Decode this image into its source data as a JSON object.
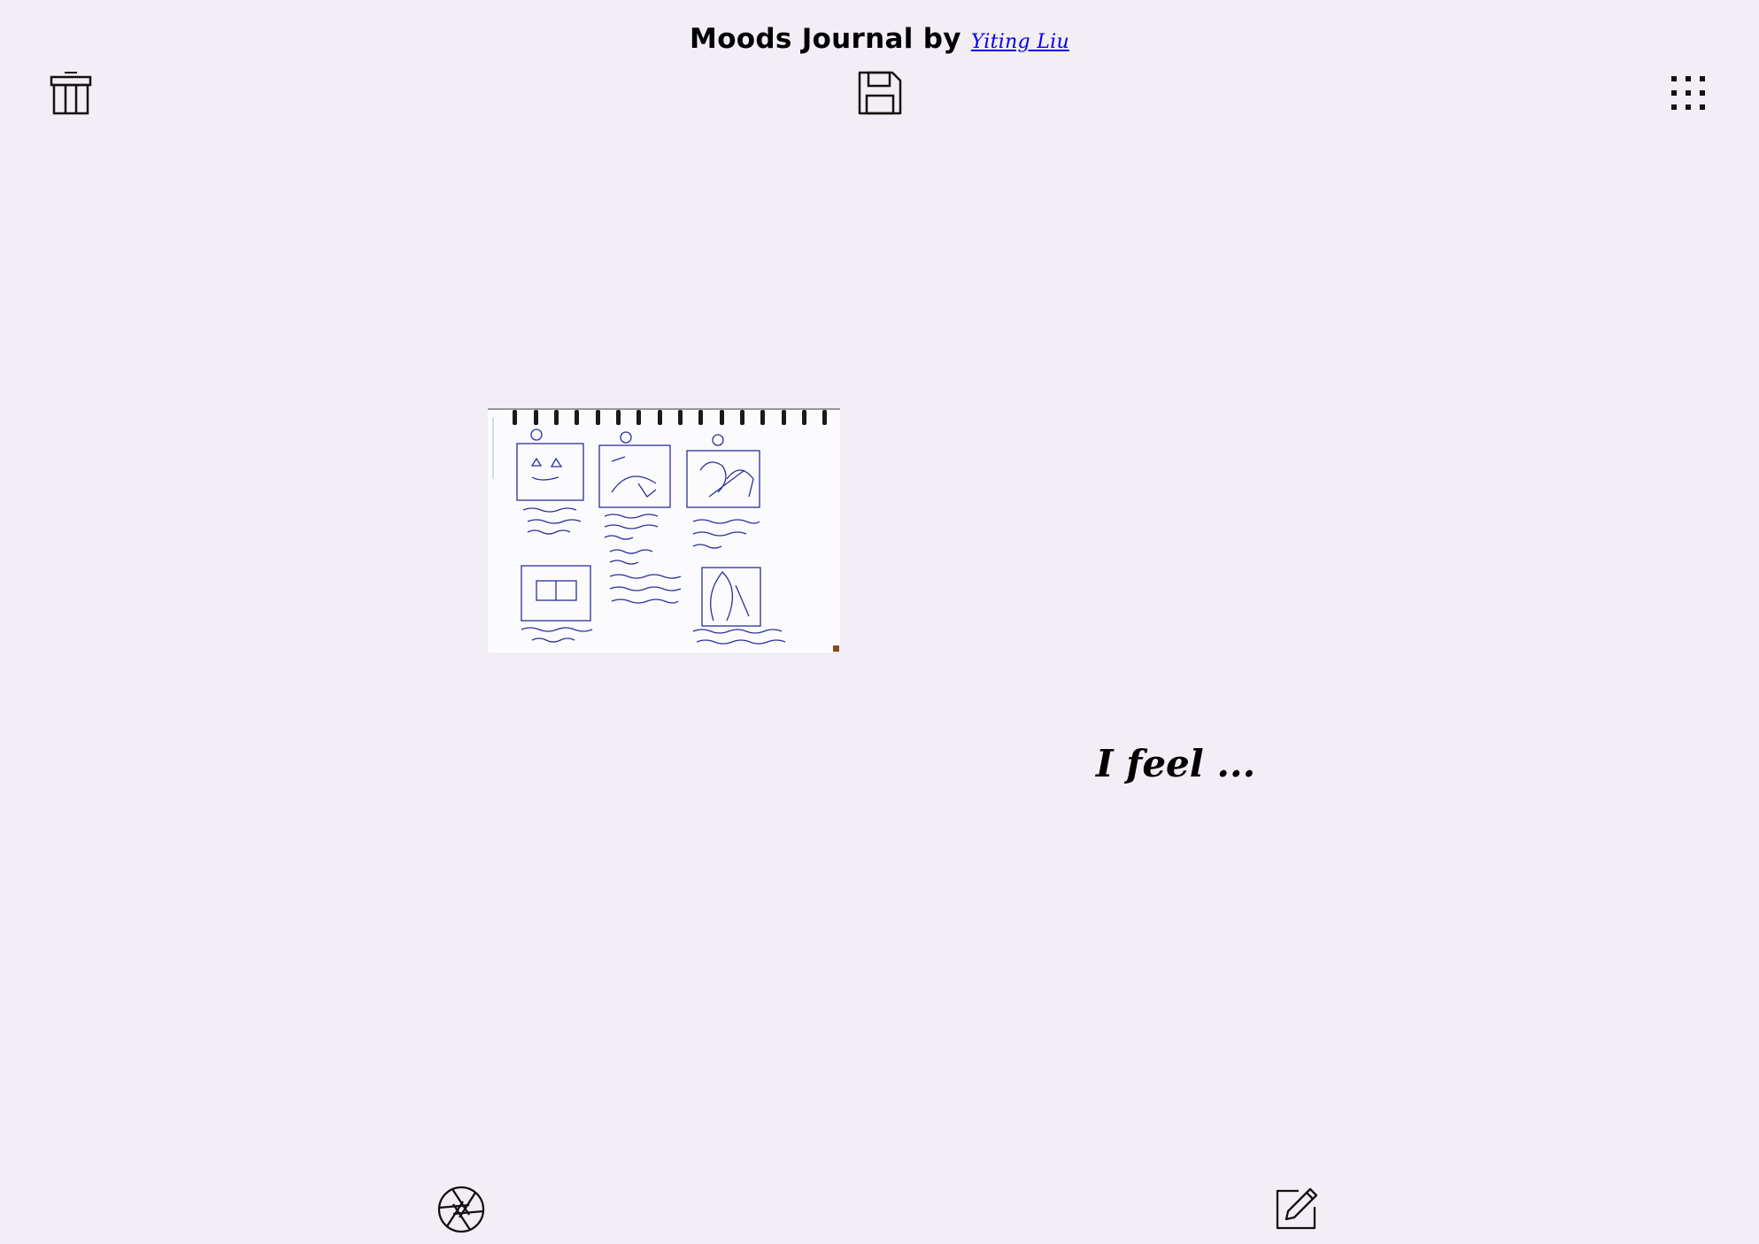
{
  "header": {
    "title": "Moods Journal",
    "by": "by",
    "author_link": "Yiting Liu"
  },
  "toolbar": {
    "delete_icon": "trash-icon",
    "save_icon": "floppy-disk-icon",
    "menu_icon": "grid-dots-icon"
  },
  "photo": {
    "description_icon": "sketch-storyboard-image"
  },
  "mood": {
    "prompt": "I feel ..."
  },
  "bottom_bar": {
    "camera_icon": "camera-aperture-icon",
    "edit_icon": "edit-pencil-icon"
  },
  "colors": {
    "background": "#f3eef5",
    "link": "#0000ee",
    "ink": "#2a2f9a"
  }
}
